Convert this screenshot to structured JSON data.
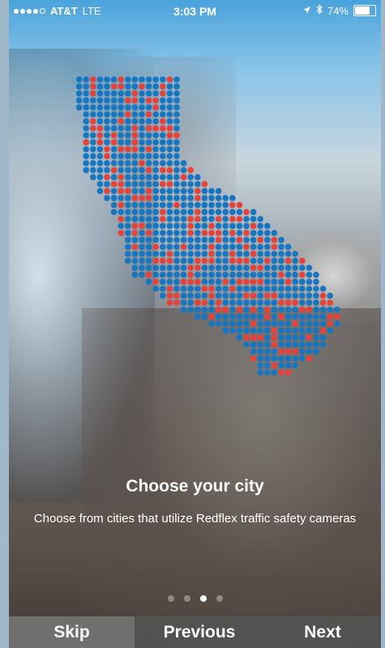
{
  "status_bar": {
    "carrier": "AT&T",
    "network": "LTE",
    "time": "3:03 PM",
    "battery_percent_text": "74%",
    "battery_level": 0.74,
    "signal_bars_filled": 4,
    "signal_bars_total": 5
  },
  "onboarding": {
    "title": "Choose your city",
    "subtitle": "Choose from cities that utilize Redflex traffic safety cameras",
    "page_count": 4,
    "active_page": 3
  },
  "navigation": {
    "skip_label": "Skip",
    "previous_label": "Previous",
    "next_label": "Next"
  },
  "colors": {
    "dot_blue": "#1676c2",
    "dot_red": "#e8413a"
  },
  "icons": {
    "location": "location-arrow-icon",
    "bluetooth": "bluetooth-icon",
    "battery": "battery-icon"
  }
}
